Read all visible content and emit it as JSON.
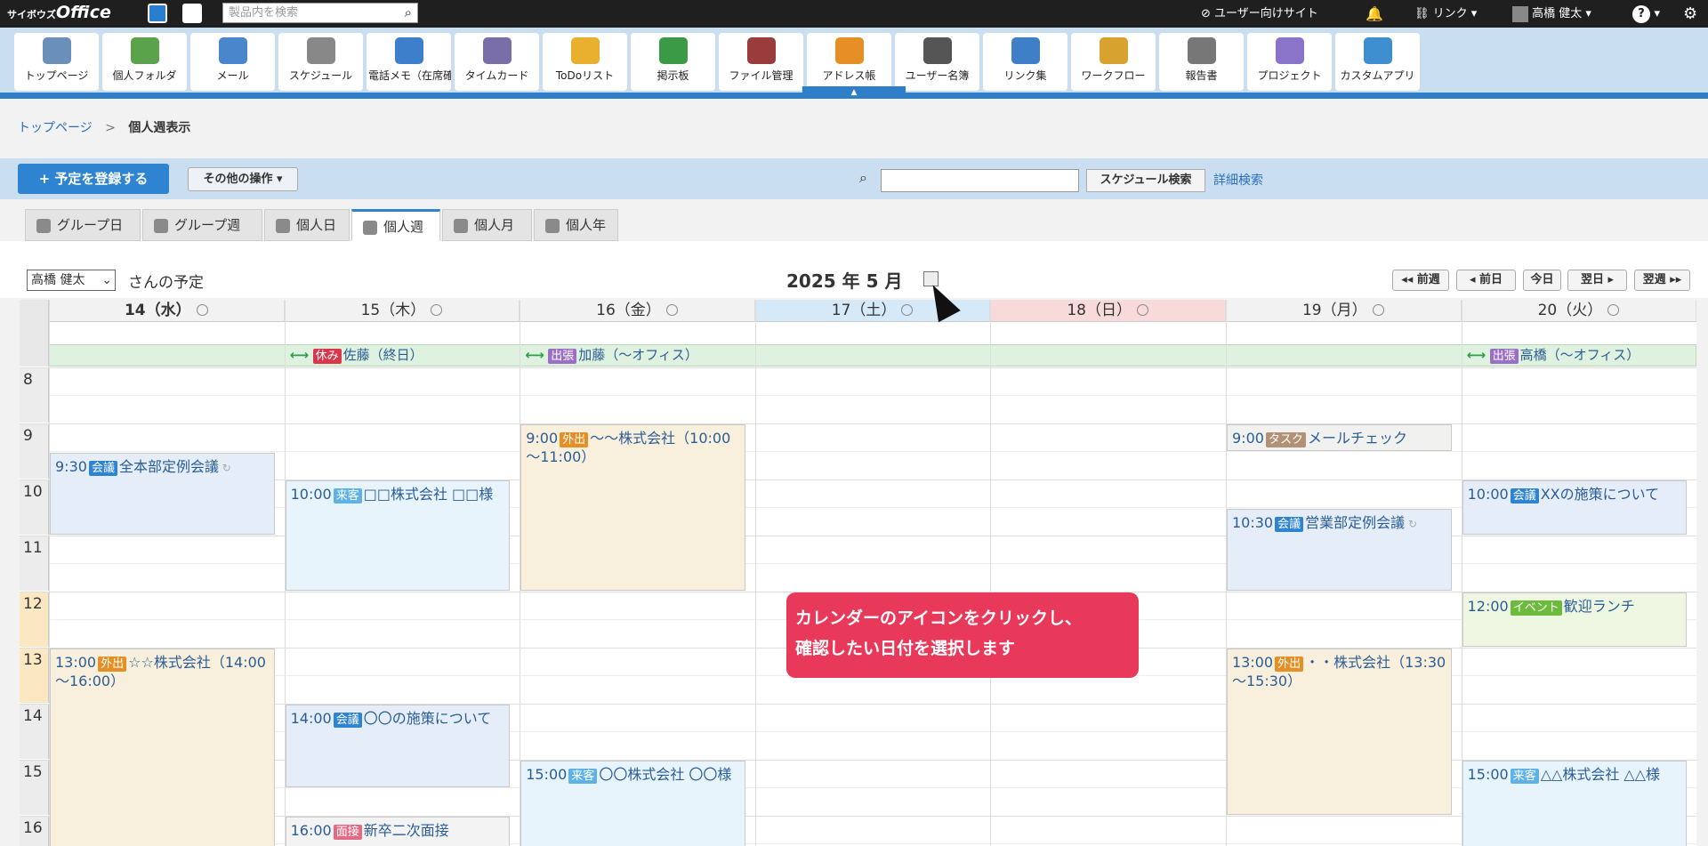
{
  "topbar": {
    "logo_prefix": "サイボウズ",
    "logo": "Office",
    "search_placeholder": "製品内を検索",
    "user_site": "ユーザー向けサイト",
    "links": "リンク",
    "user_name": "高橋 健太",
    "help": "?",
    "settings_icon": "gear-icon"
  },
  "apps": [
    {
      "label": "トップページ",
      "color": "#6a8fb8"
    },
    {
      "label": "個人フォルダ",
      "color": "#5ba34a"
    },
    {
      "label": "メール",
      "color": "#4a86cc"
    },
    {
      "label": "スケジュール",
      "color": "#888888"
    },
    {
      "label": "電話メモ（在席確認）",
      "color": "#3d7fcb"
    },
    {
      "label": "タイムカード",
      "color": "#7a6ea8"
    },
    {
      "label": "ToDoリスト",
      "color": "#e8b02e"
    },
    {
      "label": "掲示板",
      "color": "#3b9a45"
    },
    {
      "label": "ファイル管理",
      "color": "#9a3c3c"
    },
    {
      "label": "アドレス帳",
      "color": "#e58f25"
    },
    {
      "label": "ユーザー名簿",
      "color": "#555555"
    },
    {
      "label": "リンク集",
      "color": "#3f7fc7"
    },
    {
      "label": "ワークフロー",
      "color": "#d8a22e"
    },
    {
      "label": "報告書",
      "color": "#777777"
    },
    {
      "label": "プロジェクト",
      "color": "#8a74c9"
    },
    {
      "label": "カスタムアプリ",
      "color": "#3d8fd0"
    }
  ],
  "breadcrumb": {
    "home": "トップページ",
    "sep": ">",
    "current": "個人週表示"
  },
  "actions": {
    "new": "予定を登録する",
    "other": "その他の操作 ▾",
    "search_button": "スケジュール検索",
    "advanced": "詳細検索"
  },
  "tabs": [
    "グループ日",
    "グループ週",
    "個人日",
    "個人週",
    "個人月",
    "個人年"
  ],
  "week": {
    "user": "高橋 健太",
    "suffix": "さんの予定",
    "title": "2025 年 5 月",
    "nav": [
      "◂◂ 前週",
      "◂ 前日",
      "今日",
      "翌日 ▸",
      "翌週 ▸▸"
    ]
  },
  "days": [
    "14（水）",
    "15（木）",
    "16（金）",
    "17（土）",
    "18（日）",
    "19（月）",
    "20（火）"
  ],
  "hours": [
    "8",
    "9",
    "10",
    "11",
    "12",
    "13",
    "14",
    "15",
    "16"
  ],
  "allday": [
    {
      "badge": "休み",
      "text": "佐藤（終日）"
    },
    {
      "badge": "出張",
      "text": "加藤（～オフィス）"
    },
    {
      "badge": "出張",
      "text": "高橋（～オフィス）"
    }
  ],
  "events": [
    {
      "time": "9:30",
      "badge": "会議",
      "text": "全本部定例会議"
    },
    {
      "time": "13:00",
      "badge": "外出",
      "text": "☆☆株式会社（14:00～16:00）"
    },
    {
      "time": "10:00",
      "badge": "来客",
      "text": "□□株式会社 □□様"
    },
    {
      "time": "14:00",
      "badge": "会議",
      "text": "〇〇の施策について"
    },
    {
      "time": "16:00",
      "badge": "面接",
      "text": "新卒二次面接"
    },
    {
      "time": "9:00",
      "badge": "外出",
      "text": "～～株式会社（10:00～11:00）"
    },
    {
      "time": "15:00",
      "badge": "来客",
      "text": "〇〇株式会社 〇〇様"
    },
    {
      "time": "9:00",
      "badge": "タスク",
      "text": "メールチェック"
    },
    {
      "time": "10:30",
      "badge": "会議",
      "text": "営業部定例会議"
    },
    {
      "time": "13:00",
      "badge": "外出",
      "text": "・・株式会社（13:30～15:30）"
    },
    {
      "time": "10:00",
      "badge": "会議",
      "text": "XXの施策について"
    },
    {
      "time": "12:00",
      "badge": "イベント",
      "text": "歓迎ランチ"
    },
    {
      "time": "15:00",
      "badge": "来客",
      "text": "△△株式会社 △△様"
    }
  ],
  "tooltip": {
    "line1": "カレンダーのアイコンをクリックし、",
    "line2": "確認したい日付を選択します"
  },
  "colors": {
    "accent": "#2e84d0",
    "tooltip": "#e8395a"
  }
}
